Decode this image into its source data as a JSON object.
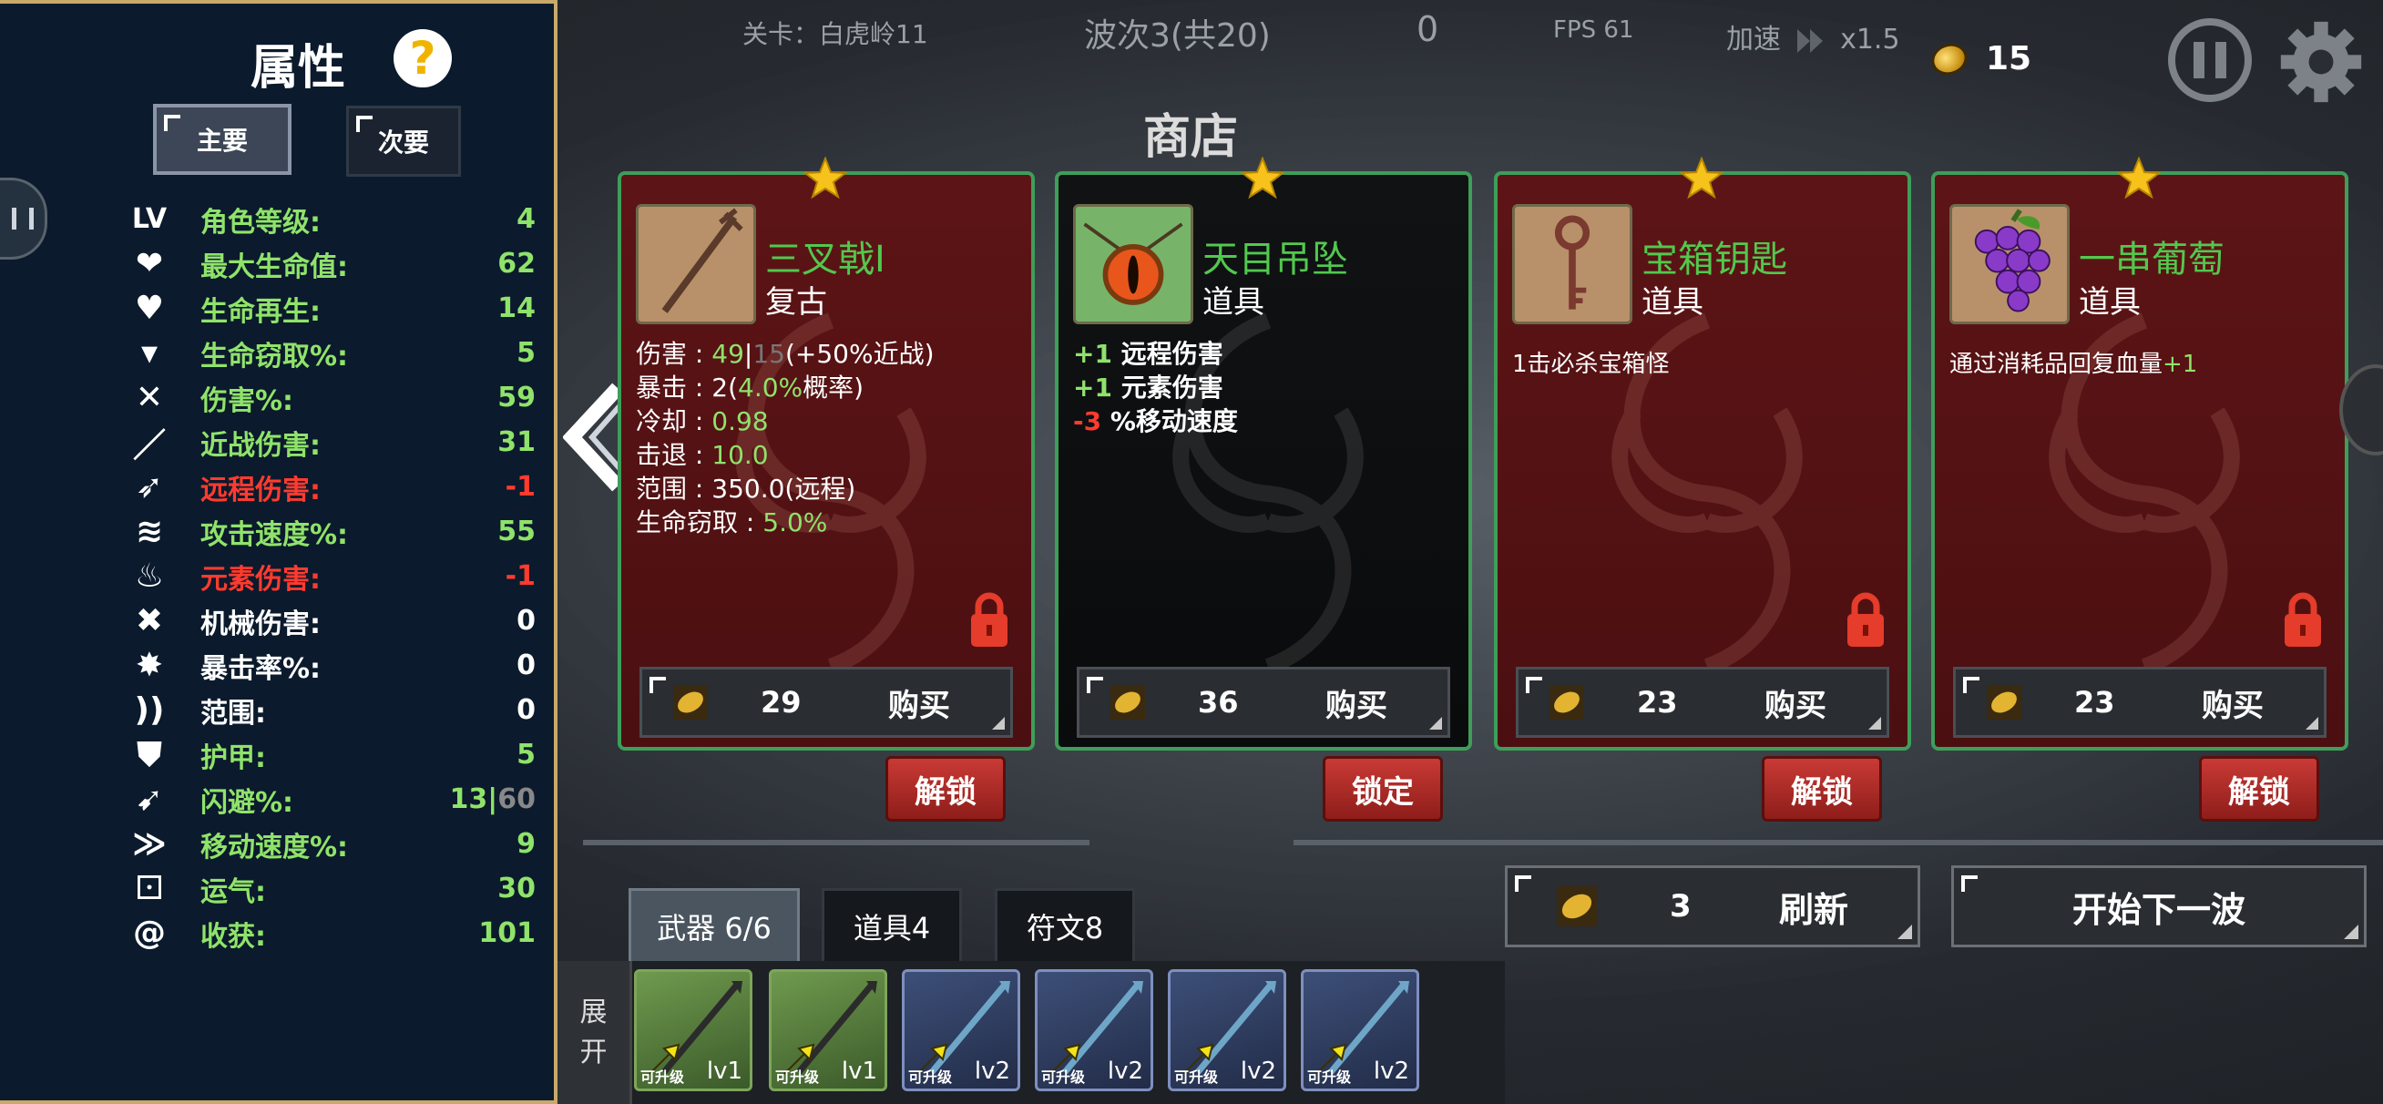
{
  "hud": {
    "level": "关卡：白虎岭11",
    "wave": "波次3(共20)",
    "score": "0",
    "fps": "FPS  61",
    "speed_label": "加速",
    "speed_value": "x1.5",
    "coins": "15",
    "icons": {
      "pause": "pause-icon",
      "settings": "gear-icon",
      "coin": "coin-icon"
    }
  },
  "attributes": {
    "title": "属性",
    "help": "?",
    "tab_main": "主要",
    "tab_sub": "次要",
    "rows": [
      {
        "icon": "LV",
        "label": "角色等级:",
        "value": "4"
      },
      {
        "icon": "heart-shield",
        "label": "最大生命值:",
        "value": "62"
      },
      {
        "icon": "heart-plus",
        "label": "生命再生:",
        "value": "14"
      },
      {
        "icon": "fangs",
        "label": "生命窃取%:",
        "value": "5"
      },
      {
        "icon": "crossed-swords",
        "label": "伤害%:",
        "value": "59"
      },
      {
        "icon": "sword",
        "label": "近战伤害:",
        "value": "31"
      },
      {
        "icon": "bow",
        "label": "远程伤害:",
        "value": "-1"
      },
      {
        "icon": "wind",
        "label": "攻击速度%:",
        "value": "55"
      },
      {
        "icon": "flame",
        "label": "元素伤害:",
        "value": "-1"
      },
      {
        "icon": "wrench",
        "label": "机械伤害:",
        "value": "0"
      },
      {
        "icon": "burst",
        "label": "暴击率%:",
        "value": "0"
      },
      {
        "icon": "range",
        "label": "范围:",
        "value": "0"
      },
      {
        "icon": "armor",
        "label": "护甲:",
        "value": "5"
      },
      {
        "icon": "dodge",
        "label": "闪避%:",
        "value": "13",
        "cap": "60"
      },
      {
        "icon": "boot",
        "label": "移动速度%:",
        "value": "9"
      },
      {
        "icon": "dice",
        "label": "运气:",
        "value": "30"
      },
      {
        "icon": "harvest",
        "label": "收获:",
        "value": "101"
      }
    ]
  },
  "shop": {
    "title": "商店",
    "items": [
      {
        "name": "三叉戟I",
        "type": "复古",
        "stats": [
          {
            "k": "伤害 : ",
            "v1": "49",
            "sep": "|",
            "v2": "15",
            "v3": "(+50%近战)"
          },
          {
            "k": "暴击 : ",
            "v1": "2(",
            "v2": "4.0%",
            "v3": "概率)"
          },
          {
            "k": "冷却 : ",
            "v1": "0.98"
          },
          {
            "k": "击退 : ",
            "v1": "10.0"
          },
          {
            "k": "范围 : ",
            "v1": "350.0(远程)"
          },
          {
            "k": "生命窃取 : ",
            "v1": "5.0%"
          }
        ],
        "price": "29",
        "buy": "购买",
        "control": "解锁",
        "locked": true
      },
      {
        "name": "天目吊坠",
        "type": "道具",
        "effects": [
          {
            "sign": "+1",
            "text": " 远程伤害",
            "neg": false
          },
          {
            "sign": "+1",
            "text": " 元素伤害",
            "neg": false
          },
          {
            "sign": "-3",
            "text": " %移动速度",
            "neg": true
          }
        ],
        "price": "36",
        "buy": "购买",
        "control": "锁定",
        "locked": false
      },
      {
        "name": "宝箱钥匙",
        "type": "道具",
        "desc": "1击必杀宝箱怪",
        "price": "23",
        "buy": "购买",
        "control": "解锁",
        "locked": true
      },
      {
        "name": "一串葡萄",
        "type": "道具",
        "desc": "通过消耗品回复血量",
        "desc_bonus": "+1",
        "price": "23",
        "buy": "购买",
        "control": "解锁",
        "locked": true
      }
    ],
    "refresh_price": "3",
    "refresh_label": "刷新",
    "next_wave": "开始下一波"
  },
  "inventory": {
    "tabs": [
      "武器 6/6",
      "道具4",
      "符文8"
    ],
    "expand": [
      "展",
      "开"
    ],
    "upgrade_label": "可升级",
    "slots": [
      {
        "lv": "lv1",
        "tier": "green"
      },
      {
        "lv": "lv1",
        "tier": "green"
      },
      {
        "lv": "lv2",
        "tier": "blue"
      },
      {
        "lv": "lv2",
        "tier": "blue"
      },
      {
        "lv": "lv2",
        "tier": "blue"
      },
      {
        "lv": "lv2",
        "tier": "blue"
      }
    ]
  },
  "colors": {
    "positive": "#8fe36a",
    "negative": "#ff3b2f",
    "card_border": "#3e9e5a",
    "unlock_button": "#c93a35",
    "panel_bg": "#0b1a2c"
  }
}
